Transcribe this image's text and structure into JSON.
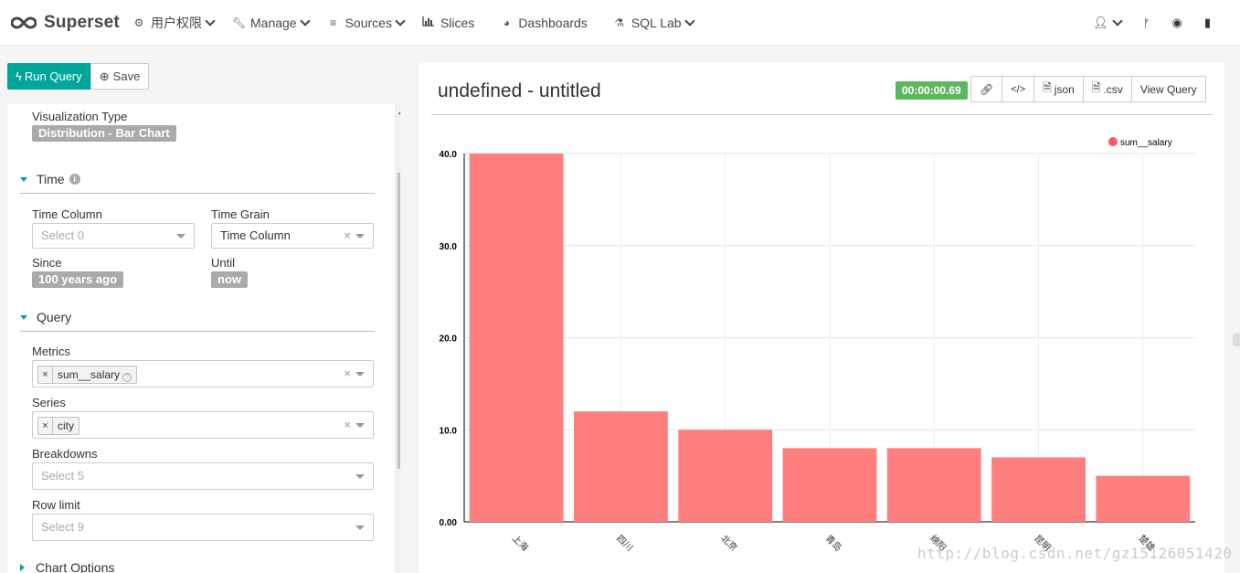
{
  "navbar": {
    "brand": "Superset",
    "items": [
      {
        "label": "用户权限",
        "icon": "gears-icon",
        "caret": true
      },
      {
        "label": "Manage",
        "icon": "wrench-icon",
        "caret": true
      },
      {
        "label": "Sources",
        "icon": "database-icon",
        "caret": true
      },
      {
        "label": "Slices",
        "icon": "bar-chart-icon",
        "caret": false
      },
      {
        "label": "Dashboards",
        "icon": "dashboard-icon",
        "caret": false
      },
      {
        "label": "SQL Lab",
        "icon": "flask-icon",
        "caret": true
      }
    ],
    "right_icons": [
      "user-icon",
      "version-icon",
      "github-icon",
      "book-icon"
    ]
  },
  "toolbar": {
    "run_label": "Run Query",
    "save_label": "Save"
  },
  "controls": {
    "viz_type_label": "Visualization Type",
    "viz_type_value": "Distribution - Bar Chart",
    "time_section": "Time",
    "time_column_label": "Time Column",
    "time_column_placeholder": "Select 0",
    "time_grain_label": "Time Grain",
    "time_grain_value": "Time Column",
    "since_label": "Since",
    "since_value": "100 years ago",
    "until_label": "Until",
    "until_value": "now",
    "query_section": "Query",
    "metrics_label": "Metrics",
    "metrics_chip": "sum__salary",
    "series_label": "Series",
    "series_chip": "city",
    "breakdowns_label": "Breakdowns",
    "breakdowns_placeholder": "Select 5",
    "row_limit_label": "Row limit",
    "row_limit_placeholder": "Select 9",
    "chart_options_section": "Chart Options",
    "clear_symbol": "×"
  },
  "chart_header": {
    "title": "undefined - untitled",
    "timer": "00:00:00.69",
    "buttons": [
      "json",
      ".csv",
      "View Query"
    ]
  },
  "chart_data": {
    "type": "bar",
    "categories": [
      "上海",
      "四川",
      "北京",
      "青岛",
      "绵阳",
      "昆明",
      "楚雄"
    ],
    "series": [
      {
        "name": "sum__salary",
        "values": [
          40,
          12,
          10,
          8,
          8,
          7,
          5
        ]
      }
    ],
    "ylim": [
      0,
      40
    ],
    "yticks": [
      "0.00",
      "10.0",
      "20.0",
      "30.0",
      "40.0"
    ],
    "grid": true,
    "legend": "top-right",
    "bar_color": "#ff7f7f",
    "legend_color": "#ff5a5f"
  },
  "watermark": "http://blog.csdn.net/gz15126051420"
}
